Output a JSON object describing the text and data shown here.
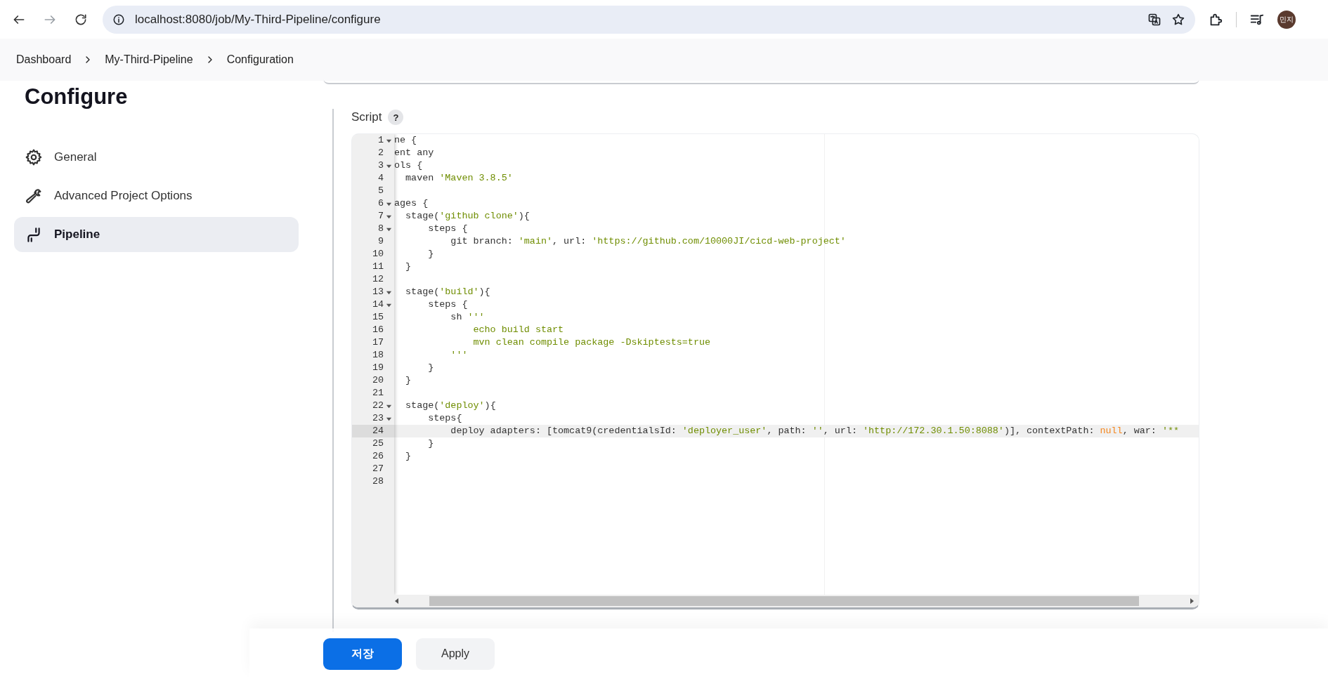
{
  "browser": {
    "url": "localhost:8080/job/My-Third-Pipeline/configure",
    "profile": "민지"
  },
  "breadcrumbs": [
    {
      "label": "Dashboard"
    },
    {
      "label": "My-Third-Pipeline"
    },
    {
      "label": "Configuration"
    }
  ],
  "sidebar": {
    "title": "Configure",
    "items": [
      {
        "label": "General",
        "kind": "gear",
        "selected": false
      },
      {
        "label": "Advanced Project Options",
        "kind": "wrench",
        "selected": false
      },
      {
        "label": "Pipeline",
        "kind": "pipeline",
        "selected": true
      }
    ]
  },
  "script": {
    "label": "Script",
    "help": "?",
    "lines": [
      {
        "number": "1",
        "fold": true,
        "active": false,
        "tokens": [
          {
            "t": "ne {",
            "kind": "plain"
          }
        ]
      },
      {
        "number": "2",
        "fold": false,
        "active": false,
        "tokens": [
          {
            "t": "ent any",
            "kind": "plain"
          }
        ]
      },
      {
        "number": "3",
        "fold": true,
        "active": false,
        "tokens": [
          {
            "t": "ols {",
            "kind": "plain"
          }
        ]
      },
      {
        "number": "4",
        "fold": false,
        "active": false,
        "tokens": [
          {
            "t": "  maven ",
            "kind": "plain"
          },
          {
            "t": "'Maven 3.8.5'",
            "kind": "string"
          }
        ]
      },
      {
        "number": "5",
        "fold": false,
        "active": false
      },
      {
        "number": "6",
        "fold": true,
        "active": false,
        "tokens": [
          {
            "t": "ages {",
            "kind": "plain"
          }
        ]
      },
      {
        "number": "7",
        "fold": true,
        "active": false,
        "tokens": [
          {
            "t": "  stage(",
            "kind": "plain"
          },
          {
            "t": "'github clone'",
            "kind": "string"
          },
          {
            "t": "){",
            "kind": "plain"
          }
        ]
      },
      {
        "number": "8",
        "fold": true,
        "active": false,
        "tokens": [
          {
            "t": "      steps {",
            "kind": "plain"
          }
        ]
      },
      {
        "number": "9",
        "fold": false,
        "active": false,
        "tokens": [
          {
            "t": "          git branch: ",
            "kind": "plain"
          },
          {
            "t": "'main'",
            "kind": "string"
          },
          {
            "t": ", url: ",
            "kind": "plain"
          },
          {
            "t": "'https://github.com/10000JI/cicd-web-project'",
            "kind": "string"
          }
        ]
      },
      {
        "number": "10",
        "fold": false,
        "active": false,
        "tokens": [
          {
            "t": "      }",
            "kind": "plain"
          }
        ]
      },
      {
        "number": "11",
        "fold": false,
        "active": false,
        "tokens": [
          {
            "t": "  }",
            "kind": "plain"
          }
        ]
      },
      {
        "number": "12",
        "fold": false,
        "active": false
      },
      {
        "number": "13",
        "fold": true,
        "active": false,
        "tokens": [
          {
            "t": "  stage(",
            "kind": "plain"
          },
          {
            "t": "'build'",
            "kind": "string"
          },
          {
            "t": "){",
            "kind": "plain"
          }
        ]
      },
      {
        "number": "14",
        "fold": true,
        "active": false,
        "tokens": [
          {
            "t": "      steps {",
            "kind": "plain"
          }
        ]
      },
      {
        "number": "15",
        "fold": false,
        "active": false,
        "tokens": [
          {
            "t": "          sh ",
            "kind": "plain"
          },
          {
            "t": "'''",
            "kind": "string"
          }
        ]
      },
      {
        "number": "16",
        "fold": false,
        "active": false,
        "tokens": [
          {
            "t": "              echo build start",
            "kind": "string"
          }
        ]
      },
      {
        "number": "17",
        "fold": false,
        "active": false,
        "tokens": [
          {
            "t": "              mvn clean compile package -Dskiptests=true",
            "kind": "string"
          }
        ]
      },
      {
        "number": "18",
        "fold": false,
        "active": false,
        "tokens": [
          {
            "t": "          '''",
            "kind": "string"
          }
        ]
      },
      {
        "number": "19",
        "fold": false,
        "active": false,
        "tokens": [
          {
            "t": "      }",
            "kind": "plain"
          }
        ]
      },
      {
        "number": "20",
        "fold": false,
        "active": false,
        "tokens": [
          {
            "t": "  }",
            "kind": "plain"
          }
        ]
      },
      {
        "number": "21",
        "fold": false,
        "active": false
      },
      {
        "number": "22",
        "fold": true,
        "active": false,
        "tokens": [
          {
            "t": "  stage(",
            "kind": "plain"
          },
          {
            "t": "'deploy'",
            "kind": "string"
          },
          {
            "t": "){",
            "kind": "plain"
          }
        ]
      },
      {
        "number": "23",
        "fold": true,
        "active": false,
        "tokens": [
          {
            "t": "      steps{",
            "kind": "plain"
          }
        ]
      },
      {
        "number": "24",
        "fold": false,
        "active": true,
        "tokens": [
          {
            "t": "          deploy adapters: [tomcat9(credentialsId: ",
            "kind": "plain"
          },
          {
            "t": "'deployer_user'",
            "kind": "string"
          },
          {
            "t": ", path: ",
            "kind": "plain"
          },
          {
            "t": "''",
            "kind": "string"
          },
          {
            "t": ", url: ",
            "kind": "plain"
          },
          {
            "t": "'http://172.30.1.50:8088'",
            "kind": "string"
          },
          {
            "t": ")], contextPath: ",
            "kind": "plain"
          },
          {
            "t": "null",
            "kind": "constant"
          },
          {
            "t": ", war: ",
            "kind": "plain"
          },
          {
            "t": "'**",
            "kind": "string"
          }
        ]
      },
      {
        "number": "25",
        "fold": false,
        "active": false,
        "tokens": [
          {
            "t": "      }",
            "kind": "plain"
          }
        ]
      },
      {
        "number": "26",
        "fold": false,
        "active": false,
        "tokens": [
          {
            "t": "  }",
            "kind": "plain"
          }
        ]
      },
      {
        "number": "27",
        "fold": false,
        "active": false
      },
      {
        "number": "28",
        "fold": false,
        "active": false
      }
    ]
  },
  "buttons": [
    {
      "label": "저장",
      "kind": "primary"
    },
    {
      "label": "Apply",
      "kind": "secondary"
    }
  ]
}
